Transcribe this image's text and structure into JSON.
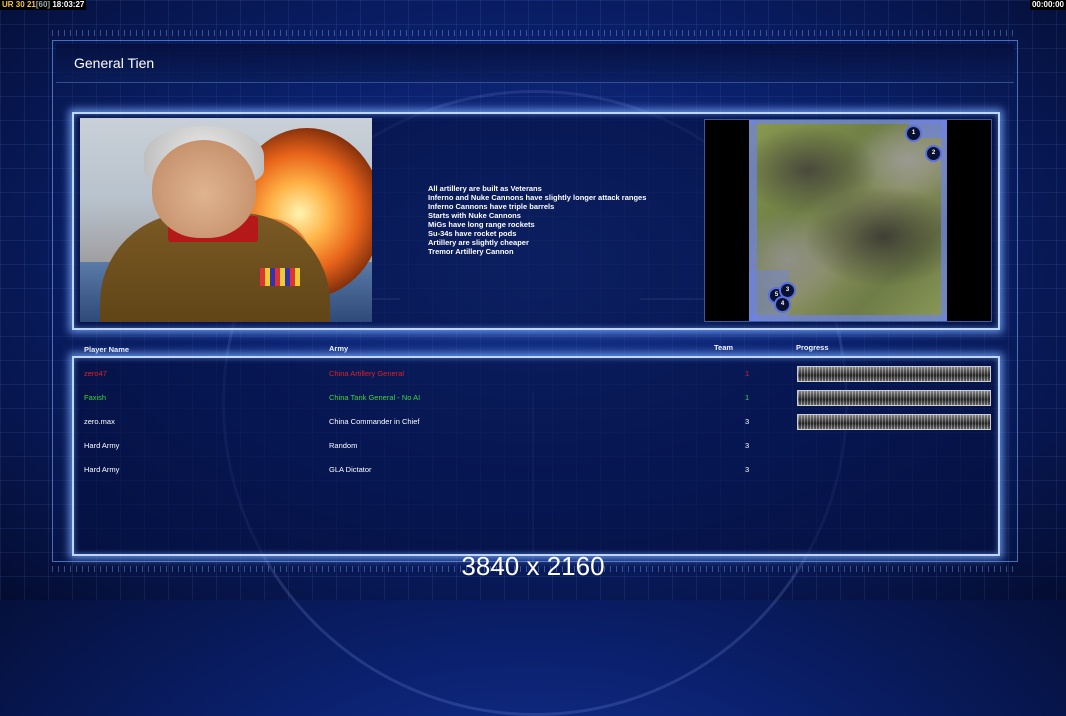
{
  "hud": {
    "left_prefix": "UR",
    "left_a": "30",
    "left_b": "21",
    "left_bracket": "[60]",
    "clock": "18:03:27",
    "timer": "00:00:00"
  },
  "general": {
    "title": "General Tien",
    "bonuses": [
      "All artillery are built as Veterans",
      "Inferno and Nuke Cannons have slightly longer attack ranges",
      "Inferno Cannons have triple barrels",
      "Starts with Nuke Cannons",
      "MiGs have long range rockets",
      "Su-34s have rocket pods",
      "Artillery are slightly cheaper",
      "Tremor Artillery Cannon"
    ]
  },
  "minimap": {
    "markers": [
      "1",
      "2",
      "3",
      "4",
      "5"
    ]
  },
  "table": {
    "headers": {
      "player": "Player Name",
      "army": "Army",
      "team": "Team",
      "progress": "Progress"
    },
    "rows": [
      {
        "player": "zero47",
        "army": "China Artillery General",
        "team": "1",
        "color": "#e02020",
        "progress": 1.0
      },
      {
        "player": "Faxish",
        "army": "China Tank General - No AI",
        "team": "1",
        "color": "#38d838",
        "progress": 1.0
      },
      {
        "player": "zero.max",
        "army": "China Commander in Chief",
        "team": "3",
        "color": "#ffffff",
        "progress": 1.0
      },
      {
        "player": "Hard Army",
        "army": "Random",
        "team": "3",
        "color": "#ffffff"
      },
      {
        "player": "Hard Army",
        "army": "GLA Dictator",
        "team": "3",
        "color": "#ffffff"
      }
    ]
  },
  "resolution_label": "3840 x 2160"
}
